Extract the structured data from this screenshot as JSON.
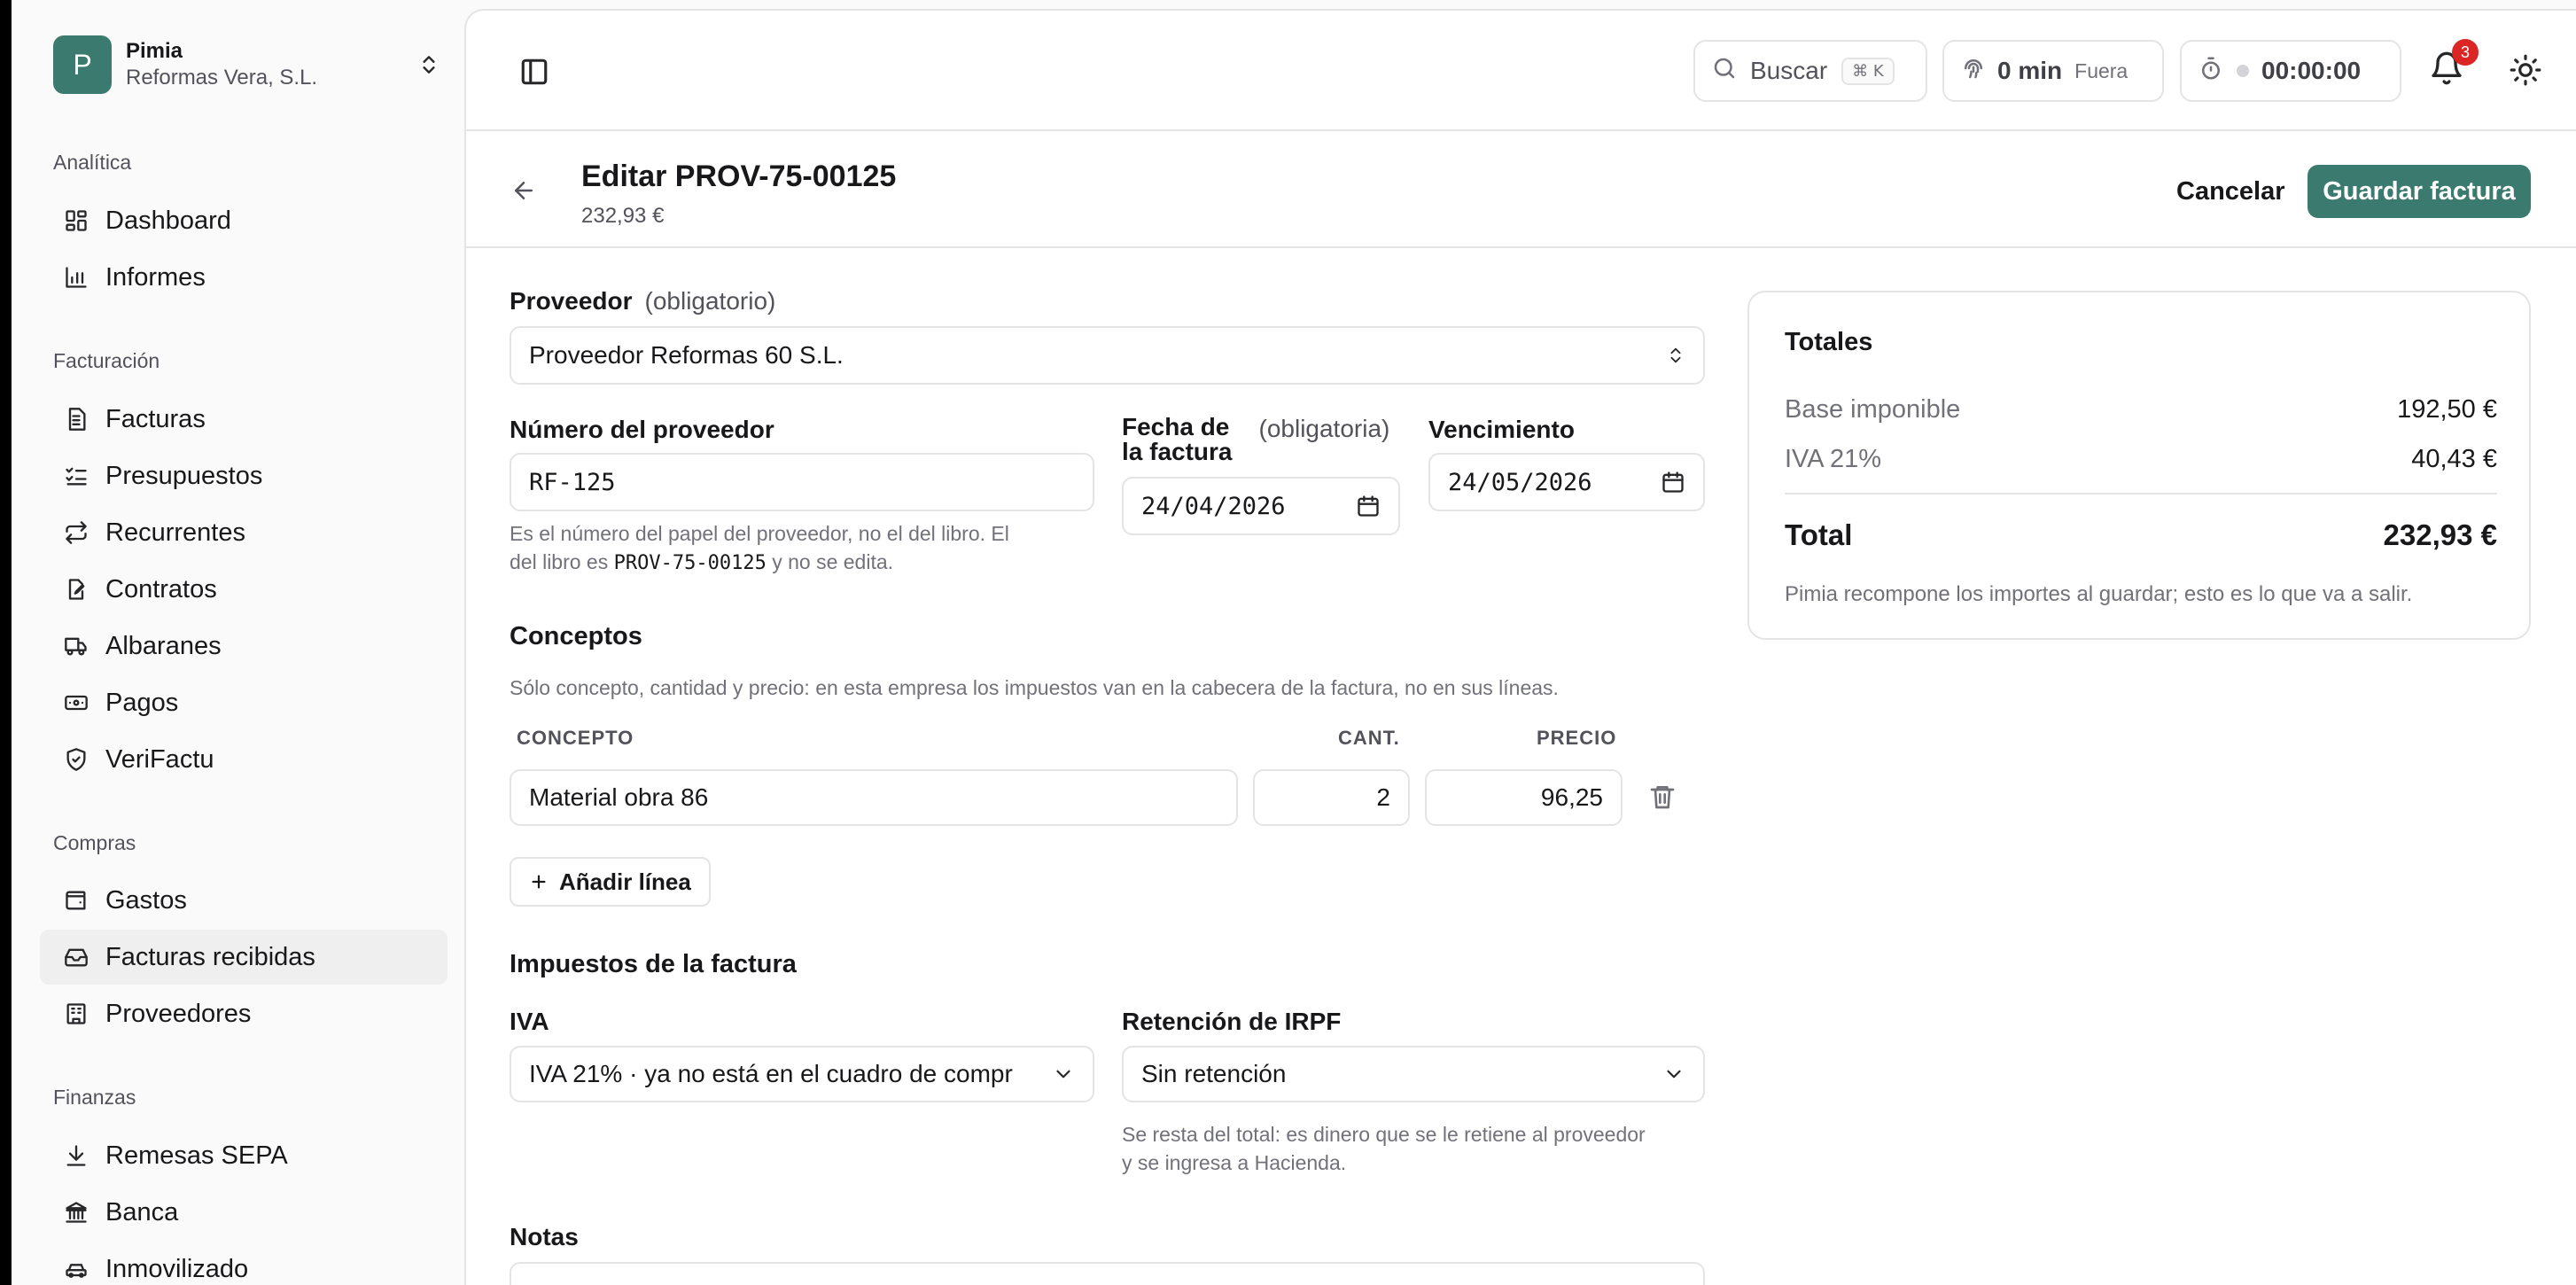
{
  "org": {
    "initial": "P",
    "name": "Pimia",
    "company": "Reformas Vera, S.L."
  },
  "sidebar": {
    "groups": [
      {
        "label": "Analítica",
        "items": [
          {
            "label": "Dashboard",
            "icon": "layout-dashboard-icon"
          },
          {
            "label": "Informes",
            "icon": "bar-chart-icon"
          }
        ]
      },
      {
        "label": "Facturación",
        "items": [
          {
            "label": "Facturas",
            "icon": "file-text-icon"
          },
          {
            "label": "Presupuestos",
            "icon": "list-checks-icon"
          },
          {
            "label": "Recurrentes",
            "icon": "repeat-icon"
          },
          {
            "label": "Contratos",
            "icon": "file-signature-icon"
          },
          {
            "label": "Albaranes",
            "icon": "truck-icon"
          },
          {
            "label": "Pagos",
            "icon": "banknote-icon"
          },
          {
            "label": "VeriFactu",
            "icon": "shield-check-icon"
          }
        ]
      },
      {
        "label": "Compras",
        "items": [
          {
            "label": "Gastos",
            "icon": "wallet-icon"
          },
          {
            "label": "Facturas recibidas",
            "icon": "inbox-icon",
            "active": true
          },
          {
            "label": "Proveedores",
            "icon": "building-icon"
          }
        ]
      },
      {
        "label": "Finanzas",
        "items": [
          {
            "label": "Remesas SEPA",
            "icon": "download-icon"
          },
          {
            "label": "Banca",
            "icon": "landmark-icon"
          },
          {
            "label": "Inmovilizado",
            "icon": "car-icon"
          }
        ]
      }
    ]
  },
  "topbar": {
    "search_label": "Buscar",
    "search_shortcut": "⌘ K",
    "attendance_value": "0 min",
    "attendance_status": "Fuera",
    "timer": "00:00:00",
    "notifications_count": "3"
  },
  "header": {
    "title": "Editar PROV-75-00125",
    "subtitle": "232,93 €",
    "cancel_label": "Cancelar",
    "save_label": "Guardar factura"
  },
  "form": {
    "supplier_label": "Proveedor",
    "supplier_required": "(obligatorio)",
    "supplier_value": "Proveedor Reformas 60 S.L.",
    "supplier_number_label": "Número del proveedor",
    "supplier_number_value": "RF-125",
    "supplier_number_help_1": "Es el número del papel del proveedor, no el del libro. El",
    "supplier_number_help_2": "del libro es",
    "supplier_number_help_code": "PROV-75-00125",
    "supplier_number_help_3": "y no se edita.",
    "invoice_date_label_1": "Fecha de",
    "invoice_date_label_2": "la factura",
    "invoice_date_required": "(obligatoria)",
    "invoice_date_value": "24/04/2026",
    "due_label": "Vencimiento",
    "due_value": "24/05/2026",
    "concepts_title": "Conceptos",
    "concepts_help": "Sólo concepto, cantidad y precio: en esta empresa los impuestos van en la cabecera de la factura, no en sus líneas.",
    "col_concept": "CONCEPTO",
    "col_qty": "CANT.",
    "col_price": "PRECIO",
    "lines": [
      {
        "concept": "Material obra 86",
        "qty": "2",
        "price": "96,25"
      }
    ],
    "add_line_label": "Añadir línea",
    "taxes_title": "Impuestos de la factura",
    "iva_label": "IVA",
    "iva_value": "IVA 21% · ya no está en el cuadro de compr",
    "irpf_label": "Retención de IRPF",
    "irpf_value": "Sin retención",
    "irpf_help_1": "Se resta del total: es dinero que se le retiene al proveedor",
    "irpf_help_2": "y se ingresa a Hacienda.",
    "notes_label": "Notas"
  },
  "totals": {
    "title": "Totales",
    "base_label": "Base imponible",
    "base_value": "192,50 €",
    "iva_label": "IVA 21%",
    "iva_value": "40,43 €",
    "total_label": "Total",
    "total_value": "232,93 €",
    "note": "Pimia recompone los importes al guardar; esto es lo que va a salir."
  },
  "colors": {
    "accent": "#3b7a6e",
    "badge": "#dc2626"
  }
}
